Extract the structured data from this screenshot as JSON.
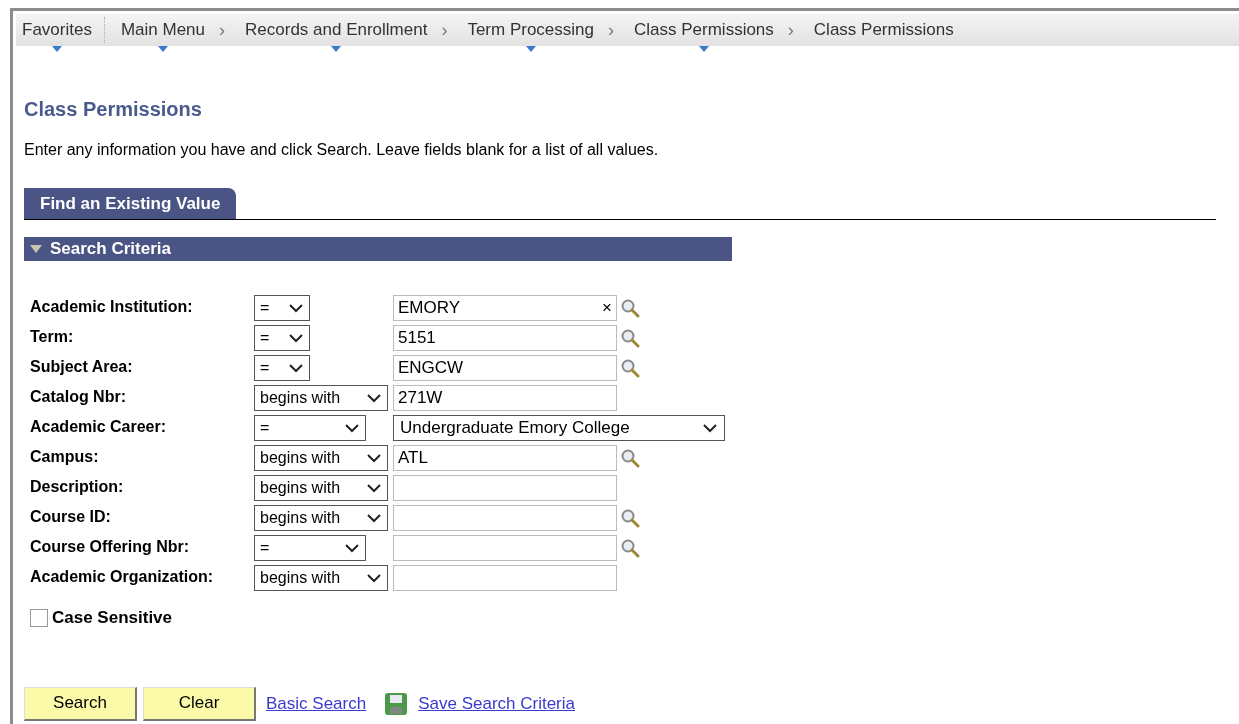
{
  "breadcrumbs": [
    {
      "label": "Favorites",
      "menu": true
    },
    {
      "label": "Main Menu",
      "menu": true
    },
    {
      "separator": "›",
      "label": "Records and Enrollment",
      "menu": true
    },
    {
      "separator": "›",
      "label": "Term Processing",
      "menu": true
    },
    {
      "separator": "›",
      "label": "Class Permissions",
      "menu": true
    },
    {
      "separator": "›",
      "label": "Class Permissions",
      "menu": false
    }
  ],
  "page_title": "Class Permissions",
  "instructions": "Enter any information you have and click Search. Leave fields blank for a list of all values.",
  "tabs": [
    {
      "label": "Find an Existing Value",
      "selected": true
    }
  ],
  "section": {
    "title": "Search Criteria",
    "expanded": true
  },
  "fields": [
    {
      "label": "Academic Institution:",
      "operator": {
        "label": "=",
        "kind": "compact"
      },
      "kind": "text",
      "value": "EMORY",
      "clear_icon": "×",
      "lookup": true
    },
    {
      "label": "Term:",
      "operator": {
        "label": "=",
        "kind": "compact"
      },
      "kind": "text",
      "value": "5151",
      "lookup": true
    },
    {
      "label": "Subject Area:",
      "operator": {
        "label": "=",
        "kind": "compact"
      },
      "kind": "text",
      "value": "ENGCW",
      "lookup": true
    },
    {
      "label": "Catalog Nbr:",
      "operator": {
        "label": "begins with",
        "kind": "full"
      },
      "kind": "text",
      "value": "271W",
      "lookup": false
    },
    {
      "label": "Academic Career:",
      "operator": {
        "label": "=",
        "kind": "wide"
      },
      "kind": "select",
      "value": "Undergraduate Emory College",
      "lookup": false
    },
    {
      "label": "Campus:",
      "operator": {
        "label": "begins with",
        "kind": "full"
      },
      "kind": "text",
      "value": "ATL",
      "lookup": true
    },
    {
      "label": "Description:",
      "operator": {
        "label": "begins with",
        "kind": "full"
      },
      "kind": "text",
      "lookup": false
    },
    {
      "label": "Course ID:",
      "operator": {
        "label": "begins with",
        "kind": "full"
      },
      "kind": "text",
      "lookup": true
    },
    {
      "label": "Course Offering Nbr:",
      "operator": {
        "label": "=",
        "kind": "wide"
      },
      "kind": "text",
      "lookup": true
    },
    {
      "label": "Academic Organization:",
      "operator": {
        "label": "begins with",
        "kind": "full"
      },
      "kind": "text",
      "lookup": false
    }
  ],
  "case_sensitive": {
    "label": "Case Sensitive",
    "checked": false
  },
  "buttons": [
    "Search",
    "Clear"
  ],
  "links": [
    {
      "label": "Basic Search",
      "icon": false
    },
    {
      "label": "Save Search Criteria",
      "icon": true
    }
  ]
}
